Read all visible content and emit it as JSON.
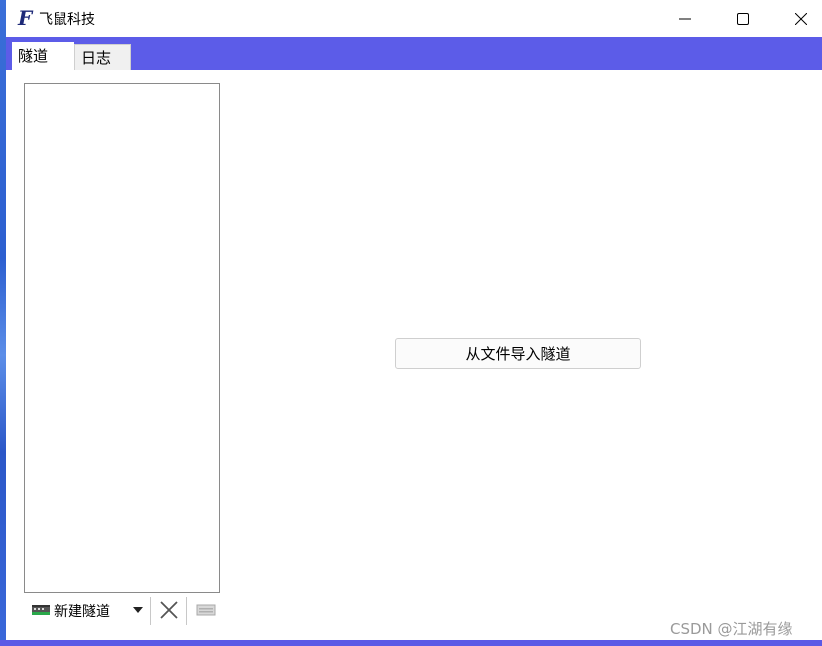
{
  "window": {
    "title": "飞鼠科技",
    "icon": "app-logo-icon",
    "app_icon_letter": "F"
  },
  "tabs": [
    {
      "label": "隧道",
      "active": true
    },
    {
      "label": "日志",
      "active": false
    }
  ],
  "tunnel_list": {
    "items": []
  },
  "toolbar": {
    "new_tunnel_label": "新建隧道",
    "new_tunnel_icon": "network-card-icon",
    "delete_icon": "close-x-icon",
    "export_icon": "export-icon"
  },
  "main": {
    "import_button_label": "从文件导入隧道"
  },
  "watermark": "CSDN @江湖有缘",
  "colors": {
    "accent": "#5c5ce8",
    "window_bg": "#ffffff"
  }
}
